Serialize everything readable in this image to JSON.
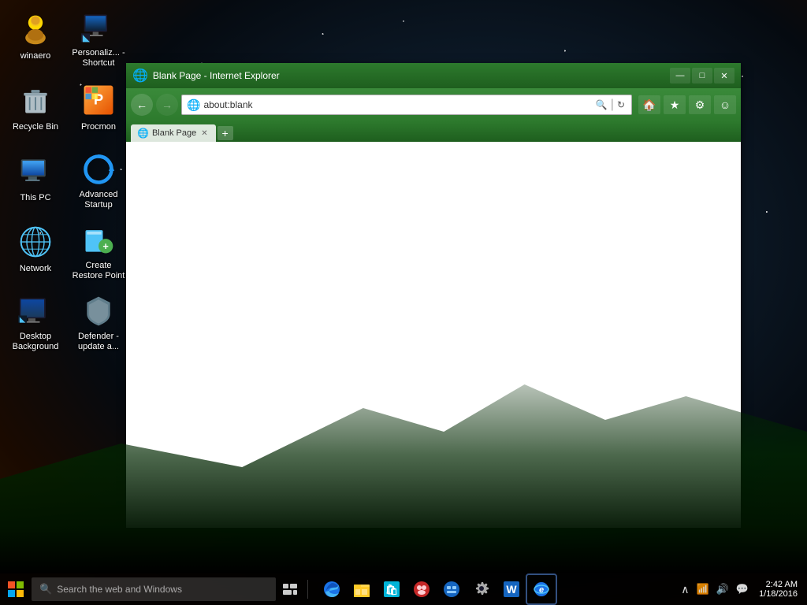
{
  "desktop": {
    "icons": [
      {
        "id": "winaero",
        "label": "winaero",
        "icon": "👤",
        "color": "#ffd700",
        "row": 0,
        "col": 0
      },
      {
        "id": "personalize",
        "label": "Personaliz... - Shortcut",
        "icon": "🖥️",
        "color": "#4fc3f7",
        "row": 0,
        "col": 1
      },
      {
        "id": "recycle-bin",
        "label": "Recycle Bin",
        "icon": "🗑️",
        "color": "#ccc",
        "row": 1,
        "col": 0
      },
      {
        "id": "procmon",
        "label": "Procmon",
        "icon": "⚙️",
        "color": "#ff9800",
        "row": 1,
        "col": 1
      },
      {
        "id": "this-pc",
        "label": "This PC",
        "icon": "💻",
        "color": "#4fc3f7",
        "row": 2,
        "col": 0
      },
      {
        "id": "advanced-startup",
        "label": "Advanced Startup",
        "icon": "🔄",
        "color": "#2196f3",
        "row": 2,
        "col": 1
      },
      {
        "id": "network",
        "label": "Network",
        "icon": "🌐",
        "color": "#4fc3f7",
        "row": 3,
        "col": 0
      },
      {
        "id": "create-restore",
        "label": "Create Restore Point",
        "icon": "🛡️",
        "color": "#4fc3f7",
        "row": 3,
        "col": 1
      },
      {
        "id": "desktop-bg",
        "label": "Desktop Background",
        "icon": "🖥️",
        "color": "#4fc3f7",
        "row": 4,
        "col": 0
      },
      {
        "id": "defender",
        "label": "Defender - update a...",
        "icon": "🛡️",
        "color": "#aaa",
        "row": 5,
        "col": 0
      }
    ]
  },
  "browser": {
    "title": "Blank Page - Internet Explorer",
    "address": "about:blank",
    "tab_label": "Blank Page",
    "back_btn": "←",
    "forward_btn": "→",
    "minimize": "—",
    "maximize": "□",
    "close": "✕",
    "home_icon": "🏠",
    "favorites_icon": "★",
    "settings_icon": "⚙",
    "smiley_icon": "☺"
  },
  "taskbar": {
    "start_icon": "⊞",
    "search_placeholder": "Search the web and Windows",
    "taskview_icon": "⧉",
    "icons": [
      {
        "id": "edge",
        "label": "Microsoft Edge",
        "icon": "🌐",
        "color": "#1a73e8"
      },
      {
        "id": "explorer",
        "label": "File Explorer",
        "icon": "📁",
        "color": "#ffd700"
      },
      {
        "id": "store",
        "label": "Windows Store",
        "icon": "🛍️",
        "color": "#00b4d8"
      },
      {
        "id": "unknown1",
        "label": "App",
        "icon": "🎮",
        "color": "#e91e63"
      },
      {
        "id": "unknown2",
        "label": "App2",
        "icon": "🔵",
        "color": "#2196f3"
      },
      {
        "id": "settings",
        "label": "Settings",
        "icon": "⚙",
        "color": "#aaa"
      },
      {
        "id": "word",
        "label": "Word",
        "icon": "W",
        "color": "#1565c0"
      },
      {
        "id": "ie",
        "label": "Internet Explorer",
        "icon": "e",
        "color": "#1a73e8"
      }
    ],
    "tray": {
      "expand_icon": "∧",
      "network_icon": "📶",
      "volume_icon": "🔊",
      "message_icon": "💬"
    },
    "clock": {
      "time": "2:42 AM",
      "date": "1/18/2016"
    }
  }
}
